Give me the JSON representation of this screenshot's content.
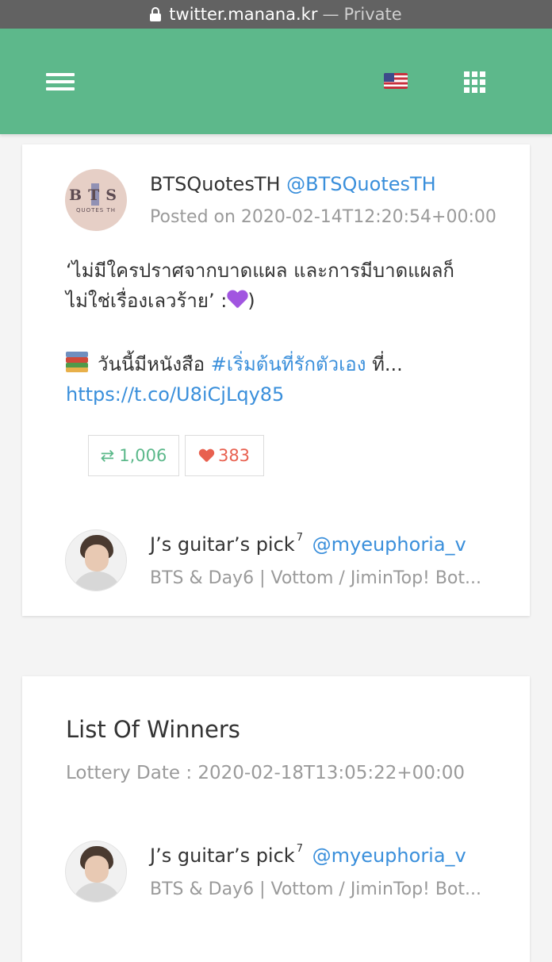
{
  "browser": {
    "url": "twitter.manana.kr",
    "separator": "—",
    "mode": "Private"
  },
  "navbar": {
    "menu_icon": "hamburger-menu-icon",
    "flag_icon": "us-flag-icon",
    "apps_icon": "grid-apps-icon",
    "background_color": "#5db88b"
  },
  "tweet": {
    "author_name": "BTSQuotesTH",
    "author_handle": "@BTSQuotesTH",
    "posted": "Posted on 2020-02-14T12:20:54+00:00",
    "avatar_label": "BTS",
    "avatar_sub": "QUOTES TH",
    "text_line1": "‘ไม่มีใครปราศจากบาดแผล และการมีบาดแผลก็",
    "text_line2_a": "ไม่ใช่เรื่องเลวร้าย’ :",
    "text_line2_b": ")",
    "text_line3_a": "วันนี้มีหนังสือ",
    "hashtag": "#เริ่มต้นที่รักตัวเอง",
    "text_line3_b": "ที่...",
    "link": "https://t.co/U8iCjLqy85",
    "retweets": "1,006",
    "likes": "383"
  },
  "participant": {
    "name": "J’s guitar’s pick",
    "superscript": "7",
    "handle": "@myeuphoria_v",
    "bio": "BTS & Day6 | Vottom / JiminTop! Bot..."
  },
  "winners": {
    "title": "List Of Winners",
    "lottery_date": "Lottery Date : 2020-02-18T13:05:22+00:00",
    "entries": [
      {
        "name": "J’s guitar’s pick",
        "superscript": "7",
        "handle": "@myeuphoria_v",
        "bio": "BTS & Day6 | Vottom / JiminTop! Bot..."
      }
    ]
  }
}
